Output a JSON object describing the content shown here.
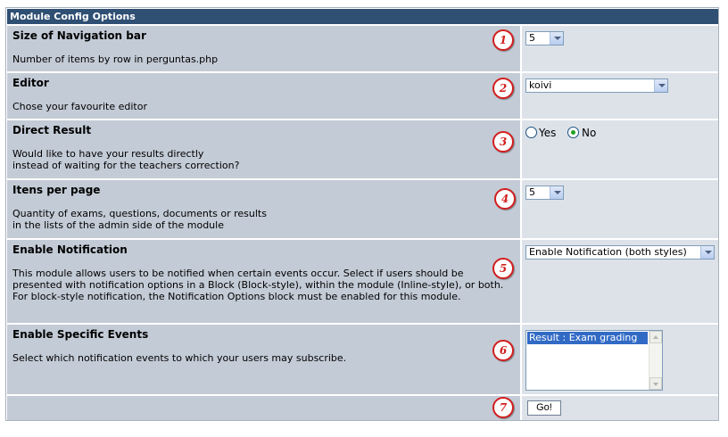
{
  "header": {
    "title": "Module Config Options"
  },
  "rows": [
    {
      "step": "1",
      "title": "Size of Navigation bar",
      "desc": "Number of items by row in perguntas.php",
      "value": "5"
    },
    {
      "step": "2",
      "title": "Editor",
      "desc": "Chose your favourite editor",
      "value": "koivi"
    },
    {
      "step": "3",
      "title": "Direct Result",
      "desc": "Would like to have your results directly\ninstead of waiting for the teachers correction?",
      "options": [
        "Yes",
        "No"
      ],
      "selected": "No"
    },
    {
      "step": "4",
      "title": "Itens per page",
      "desc": "Quantity of exams, questions, documents or results\nin the lists of the admin side of the module",
      "value": "5"
    },
    {
      "step": "5",
      "title": "Enable Notification",
      "desc": "This module allows users to be notified when certain events occur. Select if users should be presented with notification options in a Block (Block-style), within the module (Inline-style), or both. For block-style notification, the Notification Options block must be enabled for this module.",
      "value": "Enable Notification (both styles)"
    },
    {
      "step": "6",
      "title": "Enable Specific Events",
      "desc": "Select which notification events to which your users may subscribe.",
      "list": [
        "Result : Exam grading"
      ]
    },
    {
      "step": "7",
      "button": "Go!"
    }
  ],
  "colors": {
    "header": "#2f4f73",
    "label_bg": "#c3cbd6",
    "control_bg": "#dde2e9",
    "badge": "#d21e1e"
  }
}
